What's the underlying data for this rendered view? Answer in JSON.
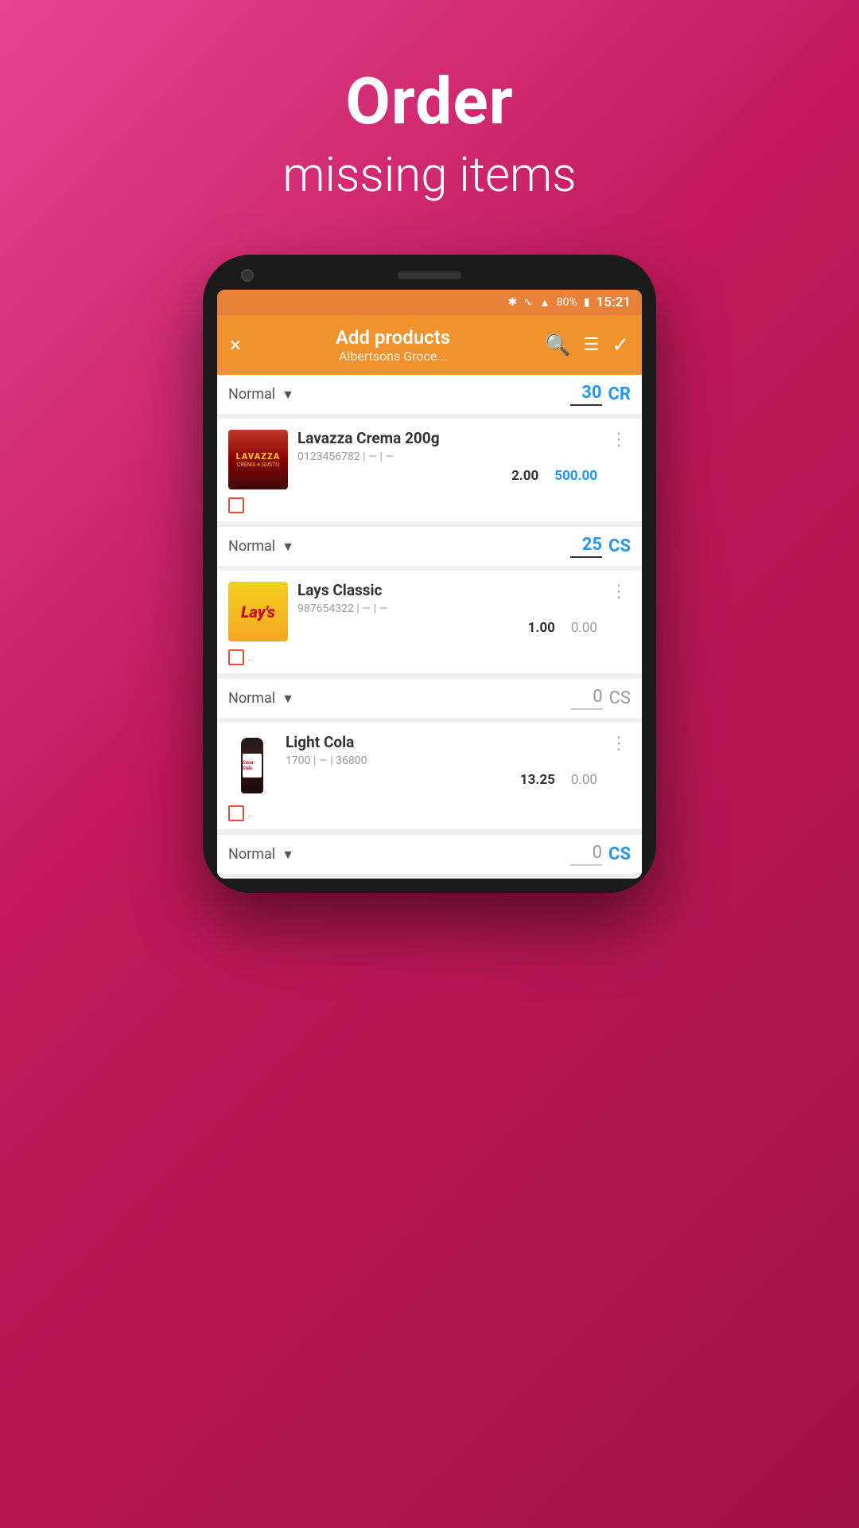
{
  "hero": {
    "title": "Order",
    "subtitle": "missing items"
  },
  "status_bar": {
    "battery": "80%",
    "time": "15:21"
  },
  "app_bar": {
    "title": "Add products",
    "subtitle": "Albertsons Groce...",
    "close_label": "×",
    "search_label": "🔍",
    "filter_label": "≡",
    "confirm_label": "✓"
  },
  "products": [
    {
      "id": "lavazza",
      "name": "Lavazza Crema 200g",
      "code": "0123456782 | — | —",
      "price": "2.00",
      "total": "500.00",
      "total_color": "blue",
      "order_type": "Normal",
      "qty": "25",
      "unit": "CS"
    },
    {
      "id": "lays",
      "name": "Lays Classic",
      "code": "987654322 | — | —",
      "price": "1.00",
      "total": "0.00",
      "total_color": "gray",
      "order_type": "Normal",
      "qty": "0",
      "unit": "CS"
    },
    {
      "id": "cola",
      "name": "Light Cola",
      "code": "1700 | — | 36800",
      "price": "13.25",
      "total": "0.00",
      "total_color": "gray",
      "order_type": "Normal",
      "qty": "0",
      "unit": "CS"
    }
  ],
  "top_order_row": {
    "type": "Normal",
    "qty": "30",
    "unit": "CR"
  }
}
